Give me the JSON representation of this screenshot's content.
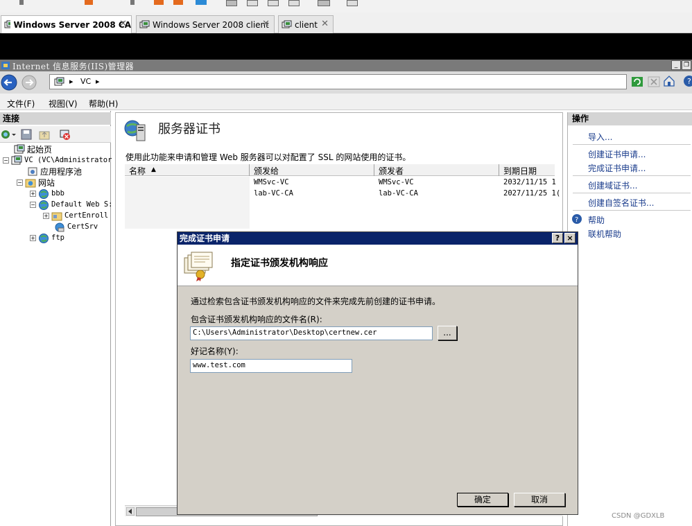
{
  "vm_tabs": [
    {
      "label": "Windows Server 2008 CA",
      "active": true
    },
    {
      "label": "Windows Server 2008 client",
      "active": false
    },
    {
      "label": "client",
      "active": false
    }
  ],
  "iis": {
    "title": "Internet 信息服务(IIS)管理器",
    "address": {
      "segment": "VC"
    },
    "menu": [
      "文件(F)",
      "视图(V)",
      "帮助(H)"
    ]
  },
  "connections": {
    "header": "连接",
    "tree": [
      {
        "label": "起始页"
      },
      {
        "label": "VC (VC\\Administrator"
      },
      {
        "label": "应用程序池"
      },
      {
        "label": "网站"
      },
      {
        "label": "bbb"
      },
      {
        "label": "Default Web S:"
      },
      {
        "label": "CertEnroll"
      },
      {
        "label": "CertSrv"
      },
      {
        "label": "ftp"
      }
    ]
  },
  "center": {
    "title": "服务器证书",
    "description": "使用此功能来申请和管理 Web 服务器可以对配置了 SSL 的网站使用的证书。",
    "columns": [
      "名称",
      "颁发给",
      "颁发者",
      "到期日期"
    ],
    "rows": [
      {
        "issued_to": "WMSvc-VC",
        "issuer": "WMSvc-VC",
        "expires": "2032/11/15 1"
      },
      {
        "issued_to": "lab-VC-CA",
        "issuer": "lab-VC-CA",
        "expires": "2027/11/25 1("
      }
    ]
  },
  "actions": {
    "header": "操作",
    "items": [
      "导入...",
      "创建证书申请...",
      "完成证书申请...",
      "创建域证书...",
      "创建自签名证书...",
      "帮助",
      "联机帮助"
    ]
  },
  "dialog": {
    "title": "完成证书申请",
    "heading": "指定证书颁发机构响应",
    "instruction": "通过检索包含证书颁发机构响应的文件来完成先前创建的证书申请。",
    "file_label": "包含证书颁发机构响应的文件名(R):",
    "file_value": "C:\\Users\\Administrator\\Desktop\\certnew.cer",
    "browse_label": "...",
    "friendly_label": "好记名称(Y):",
    "friendly_value": "www.test.com",
    "ok_label": "确定",
    "cancel_label": "取消",
    "help_btn": "?",
    "close_btn": "×"
  },
  "watermark": "CSDN @GDXLB",
  "colors": {
    "dialog_title": "#0a246a",
    "action_link": "#1a3c8c",
    "dialog_face": "#d4d0c8"
  }
}
